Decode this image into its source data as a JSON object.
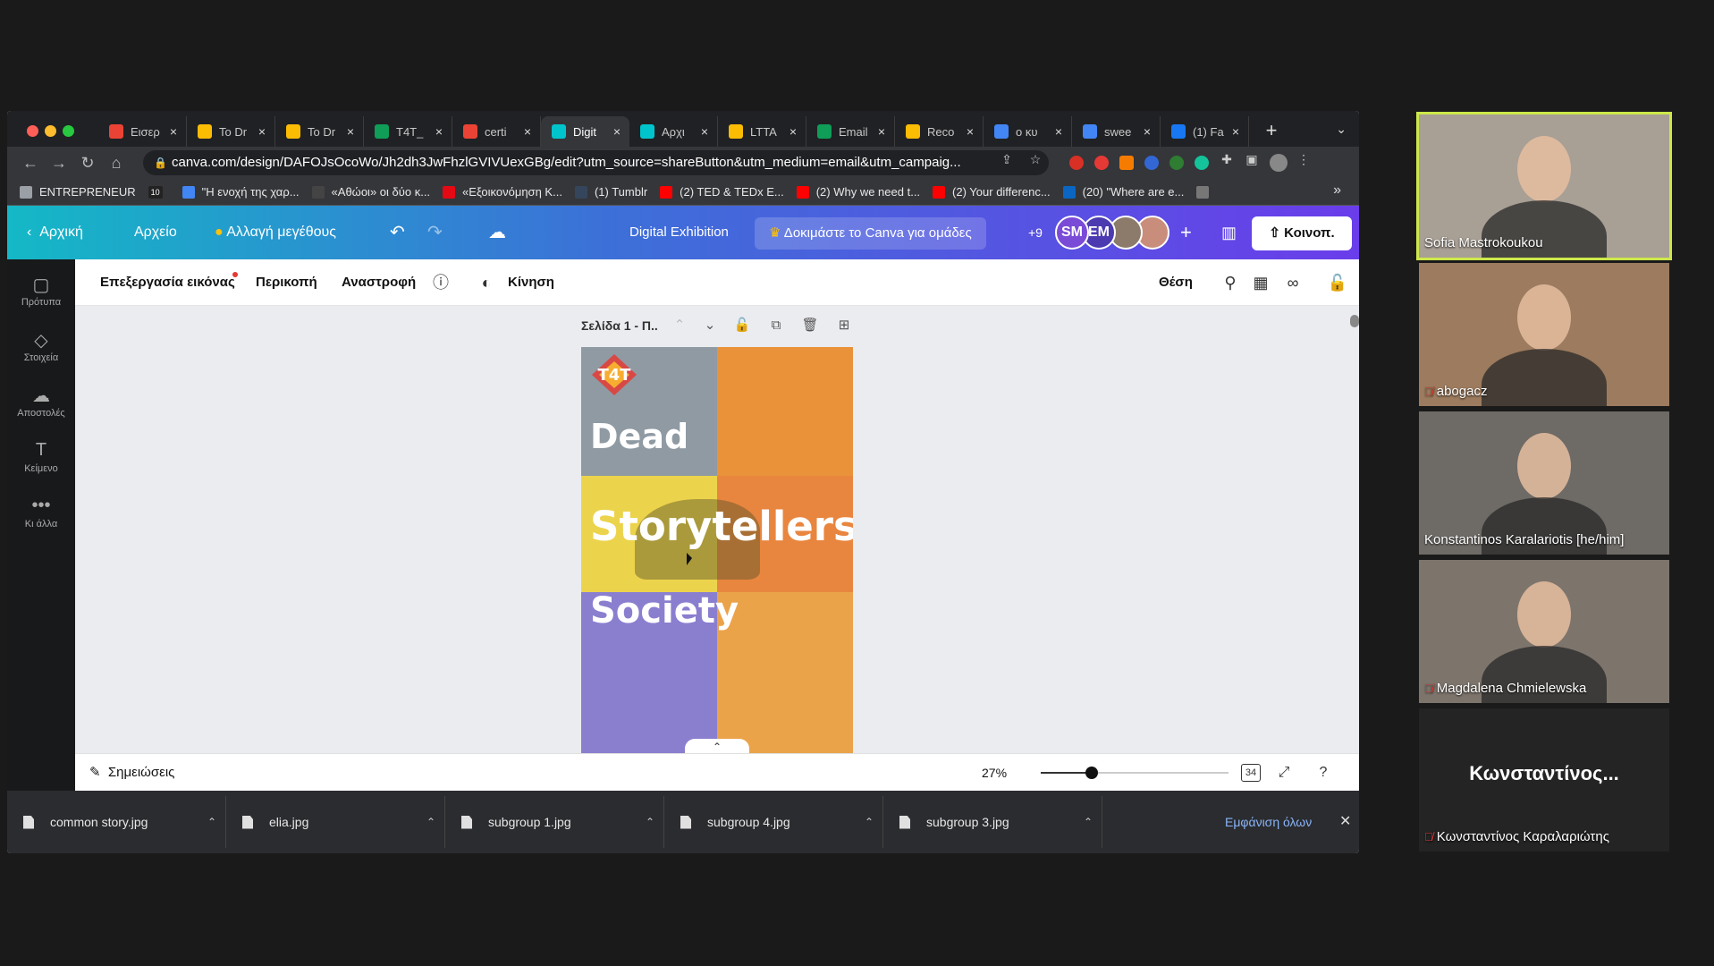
{
  "browser": {
    "tabs": [
      {
        "label": "Εισερ",
        "favicon": "gmail-icon",
        "color": "#ea4335",
        "active": false
      },
      {
        "label": "To Dr",
        "favicon": "drive-icon",
        "color": "#fbbc04",
        "active": false
      },
      {
        "label": "To Dr",
        "favicon": "drive-icon",
        "color": "#fbbc04",
        "active": false
      },
      {
        "label": "T4T_",
        "favicon": "sheets-icon",
        "color": "#0f9d58",
        "active": false
      },
      {
        "label": "certi",
        "favicon": "gmail-icon",
        "color": "#ea4335",
        "active": false
      },
      {
        "label": "Digit",
        "favicon": "canva-icon",
        "color": "#00c4cc",
        "active": true
      },
      {
        "label": "Αρχι",
        "favicon": "canva-icon",
        "color": "#00c4cc",
        "active": false
      },
      {
        "label": "LTTA",
        "favicon": "drive-icon",
        "color": "#fbbc04",
        "active": false
      },
      {
        "label": "Email",
        "favicon": "sheets-icon",
        "color": "#0f9d58",
        "active": false
      },
      {
        "label": "Reco",
        "favicon": "drive-icon",
        "color": "#fbbc04",
        "active": false
      },
      {
        "label": "ο κυ",
        "favicon": "google-icon",
        "color": "#4285f4",
        "active": false
      },
      {
        "label": "swee",
        "favicon": "google-icon",
        "color": "#4285f4",
        "active": false
      },
      {
        "label": "(1) Fa",
        "favicon": "facebook-icon",
        "color": "#1877f2",
        "active": false
      }
    ],
    "url": "canva.com/design/DAFOJsOcoWo/Jh2dh3JwFhzlGVIVUexGBg/edit?utm_source=shareButton&utm_medium=email&utm_campaig...",
    "bookmarks": [
      {
        "label": "ENTREPRENEUR",
        "color": "#9aa0a6"
      },
      {
        "label": "",
        "color": "#222222",
        "badge": "10"
      },
      {
        "label": "\"Η ενοχή της χαρ...",
        "color": "#4285f4"
      },
      {
        "label": "«Αθώοι» οι δύο κ...",
        "color": "#444444"
      },
      {
        "label": "«Εξοικονόμηση Κ...",
        "color": "#e50914"
      },
      {
        "label": "(1) Tumblr",
        "color": "#35465c"
      },
      {
        "label": "(2) TED & TEDx E...",
        "color": "#ff0000"
      },
      {
        "label": "(2) Why we need t...",
        "color": "#ff0000"
      },
      {
        "label": "(2) Your differenc...",
        "color": "#ff0000"
      },
      {
        "label": "(20) \"Where are e...",
        "color": "#0a66c2"
      },
      {
        "label": "",
        "color": "#777777"
      }
    ],
    "bookmarks_more": "»"
  },
  "canva": {
    "home_label": "Αρχική",
    "file_label": "Αρχείο",
    "resize_label": "Αλλαγή μεγέθους",
    "design_title": "Digital Exhibition",
    "try_team_label": "Δοκιμάστε το Canva για ομάδες",
    "more_collaborators": "+9",
    "avatars": [
      {
        "initials": "SM",
        "color": "#7a4bd6"
      },
      {
        "initials": "EM",
        "color": "#4b3ab0"
      },
      {
        "initials": "",
        "color": "#8c7b6a"
      },
      {
        "initials": "",
        "color": "#c98d7b"
      }
    ],
    "share_label": "Κοινοπ.",
    "sidebar": [
      {
        "label": "Πρότυπα",
        "icon": "templates-icon",
        "glyph": "▢"
      },
      {
        "label": "Στοιχεία",
        "icon": "elements-icon",
        "glyph": "◇"
      },
      {
        "label": "Αποστολές",
        "icon": "uploads-icon",
        "glyph": "☁"
      },
      {
        "label": "Κείμενο",
        "icon": "text-icon",
        "glyph": "T"
      },
      {
        "label": "Κι άλλα",
        "icon": "more-icon",
        "glyph": "•••"
      }
    ],
    "context_toolbar": {
      "edit_image": "Επεξεργασία εικόνας",
      "crop": "Περικοπή",
      "flip": "Αναστροφή",
      "animate": "Κίνηση",
      "position": "Θέση"
    },
    "page": {
      "label": "Σελίδα 1 - Π.."
    },
    "design": {
      "logo_text": "T4T",
      "lines": [
        "Dead",
        "Storytellers",
        "Society"
      ]
    },
    "bottom": {
      "notes_label": "Σημειώσεις",
      "zoom": "27%",
      "zoom_fraction": 0.27,
      "page_count": "34"
    }
  },
  "downloads": {
    "items": [
      "common story.jpg",
      "elia.jpg",
      "subgroup 1.jpg",
      "subgroup 4.jpg",
      "subgroup 3.jpg"
    ],
    "show_all": "Εμφάνιση όλων"
  },
  "participants": [
    {
      "name": "Sofia Mastrokoukou",
      "muted": false,
      "active_speaker": true,
      "bg": "#a89f95"
    },
    {
      "name": "abogacz",
      "muted": true,
      "active_speaker": false,
      "bg": "#9c7b5e"
    },
    {
      "name": "Konstantinos Karalariotis [he/him]",
      "muted": false,
      "active_speaker": false,
      "bg": "#6e6a66"
    },
    {
      "name": "Magdalena Chmielewska",
      "muted": true,
      "active_speaker": false,
      "bg": "#7d756c"
    },
    {
      "name": "Κωνσταντίνος Καραλαριώτης",
      "muted": true,
      "active_speaker": false,
      "bg": "#242424",
      "display_text": "Κωνσταντίνος..."
    }
  ]
}
